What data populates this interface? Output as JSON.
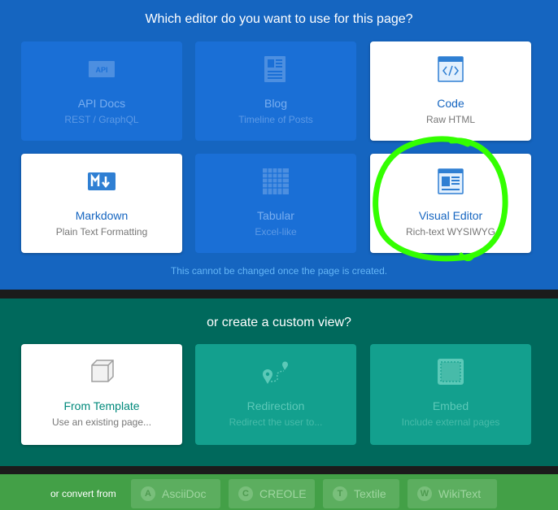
{
  "editor_section": {
    "heading": "Which editor do you want to use for this page?",
    "notice": "This cannot be changed once the page is created.",
    "cards": [
      {
        "title": "API Docs",
        "sub": "REST / GraphQL",
        "icon": "api-icon",
        "state": "disabled"
      },
      {
        "title": "Blog",
        "sub": "Timeline of Posts",
        "icon": "blog-icon",
        "state": "disabled"
      },
      {
        "title": "Code",
        "sub": "Raw HTML",
        "icon": "code-icon",
        "state": "active"
      },
      {
        "title": "Markdown",
        "sub": "Plain Text Formatting",
        "icon": "markdown-icon",
        "state": "active"
      },
      {
        "title": "Tabular",
        "sub": "Excel-like",
        "icon": "table-icon",
        "state": "disabled"
      },
      {
        "title": "Visual Editor",
        "sub": "Rich-text WYSIWYG",
        "icon": "visual-editor-icon",
        "state": "active"
      }
    ],
    "api_icon_text": "API"
  },
  "custom_section": {
    "heading": "or create a custom view?",
    "cards": [
      {
        "title": "From Template",
        "sub": "Use an existing page...",
        "icon": "template-icon",
        "state": "active"
      },
      {
        "title": "Redirection",
        "sub": "Redirect the user to...",
        "icon": "redirection-icon",
        "state": "disabled"
      },
      {
        "title": "Embed",
        "sub": "Include external pages",
        "icon": "embed-icon",
        "state": "disabled"
      }
    ]
  },
  "convert_section": {
    "label": "or convert from",
    "chips": [
      {
        "letter": "A",
        "label": "AsciiDoc"
      },
      {
        "letter": "C",
        "label": "CREOLE"
      },
      {
        "letter": "T",
        "label": "Textile"
      },
      {
        "letter": "W",
        "label": "WikiText"
      }
    ]
  },
  "colors": {
    "editor_bg": "#1565c0",
    "custom_bg": "#00695c",
    "convert_bg": "#43a047",
    "highlight": "#33ff00"
  },
  "annotation": {
    "icon": "hand-drawn-highlight-circle"
  }
}
